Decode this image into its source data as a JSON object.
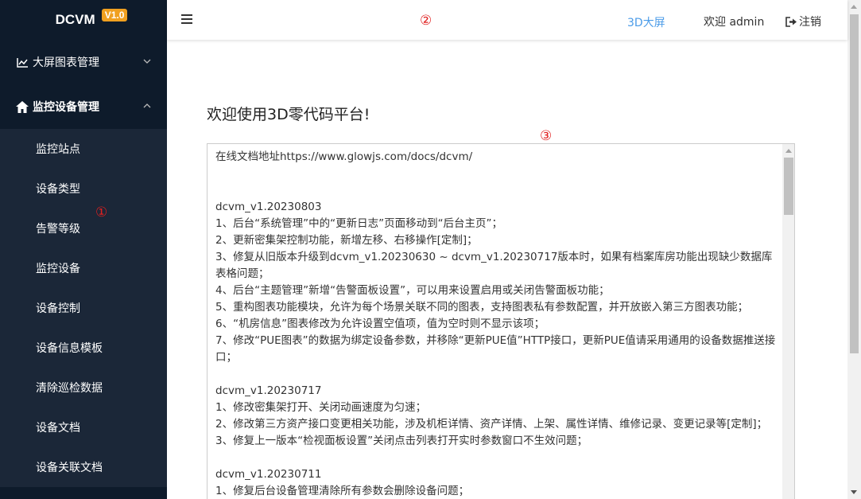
{
  "app": {
    "logo": "DCVM",
    "version": "V1.0"
  },
  "sidebar": {
    "groups": [
      {
        "label": "大屏图表管理",
        "icon": "line-chart-icon",
        "expanded": false
      },
      {
        "label": "监控设备管理",
        "icon": "home-icon",
        "expanded": true
      }
    ],
    "items": [
      {
        "label": "监控站点"
      },
      {
        "label": "设备类型"
      },
      {
        "label": "告警等级"
      },
      {
        "label": "监控设备"
      },
      {
        "label": "设备控制"
      },
      {
        "label": "设备信息模板"
      },
      {
        "label": "清除巡检数据"
      },
      {
        "label": "设备文档"
      },
      {
        "label": "设备关联文档"
      }
    ],
    "marker": "①"
  },
  "header": {
    "marker": "②",
    "link_3d": "3D大屏",
    "welcome": "欢迎 admin",
    "logout": "注销"
  },
  "main": {
    "title": "欢迎使用3D零代码平台!",
    "marker": "③",
    "doc_lines": [
      "在线文档地址https://www.glowjs.com/docs/dcvm/",
      "",
      "",
      "dcvm_v1.20230803",
      "1、后台“系统管理”中的“更新日志”页面移动到“后台主页”；",
      "2、更新密集架控制功能，新增左移、右移操作[定制]；",
      "3、修复从旧版本升级到dcvm_v1.20230630 ~ dcvm_v1.20230717版本时，如果有档案库房功能出现缺少数据库表格问题；",
      "4、后台“主题管理”新增“告警面板设置”，可以用来设置启用或关闭告警面板功能；",
      "5、重构图表功能模块，允许为每个场景关联不同的图表，支持图表私有参数配置，并开放嵌入第三方图表功能；",
      "6、“机房信息”图表修改为允许设置空值项，值为空时则不显示该项；",
      "7、修改“PUE图表”的数据为绑定设备参数，并移除“更新PUE值”HTTP接口，更新PUE值请采用通用的设备数据推送接口；",
      "",
      "dcvm_v1.20230717",
      "1、修改密集架打开、关闭动画速度为匀速；",
      "2、修改第三方资产接口变更相关功能，涉及机柜详情、资产详情、上架、属性详情、维修记录、变更记录等[定制]；",
      "3、修复上一版本“检视面板设置”关闭点击列表打开实时参数窗口不生效问题；",
      "",
      "dcvm_v1.20230711",
      "1、修复后台设备管理清除所有参数会删除设备问题；"
    ]
  }
}
